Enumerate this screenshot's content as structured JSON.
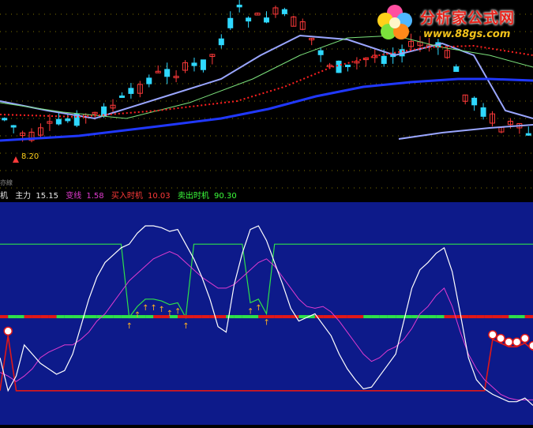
{
  "watermark": {
    "site_name": "分析家公式网",
    "url": "www.88gs.com"
  },
  "upper_chart": {
    "low_price_marker": "8.20",
    "left_edge_text": "亦線"
  },
  "indicator_bar": {
    "items": [
      {
        "label": "机",
        "value": "",
        "color": "#e8e8e8"
      },
      {
        "label": "主力",
        "value": "15.15",
        "color": "#e8e8e8"
      },
      {
        "label": "变线",
        "value": "1.58",
        "color": "#e23bd0"
      },
      {
        "label": "买入时机",
        "value": "10.03",
        "color": "#ff3a3a"
      },
      {
        "label": "卖出时机",
        "value": "90.30",
        "color": "#3cff3c"
      }
    ]
  },
  "colors": {
    "up_candle": "#ff3a3a",
    "down_candle": "#2fd8ff",
    "ma_short": "#9aa6ff",
    "ma_mid": "#7ce27c",
    "ma_long": "#2038ff",
    "ma_dotted": "#ff2020",
    "main_line": "#ffffff",
    "signal_line": "#e23bd0",
    "buy_band": "#2ee04a",
    "sell_band": "#e01818",
    "lower_bg": "#0d1a8a"
  },
  "chart_data": {
    "type": "line",
    "x": [
      1,
      2,
      3,
      4,
      5,
      6,
      7,
      8,
      9,
      10,
      11,
      12,
      13,
      14,
      15,
      16,
      17,
      18,
      19,
      20,
      21,
      22,
      23,
      24,
      25,
      26,
      27,
      28,
      29,
      30,
      31,
      32,
      33,
      34,
      35,
      36,
      37,
      38,
      39,
      40,
      41,
      42,
      43,
      44,
      45,
      46,
      47,
      48,
      49,
      50,
      51,
      52,
      53,
      54,
      55,
      56,
      57,
      58,
      59,
      60,
      61,
      62,
      63,
      64,
      65,
      66,
      67
    ],
    "series": [
      {
        "name": "主力",
        "values": [
          28,
          10,
          18,
          35,
          30,
          25,
          22,
          19,
          21,
          30,
          45,
          60,
          72,
          80,
          84,
          88,
          90,
          96,
          100,
          100,
          99,
          97,
          98,
          90,
          82,
          72,
          60,
          45,
          42,
          68,
          85,
          98,
          100,
          92,
          80,
          68,
          55,
          48,
          50,
          52,
          46,
          40,
          30,
          22,
          16,
          11,
          12,
          18,
          24,
          30,
          48,
          66,
          76,
          80,
          85,
          88,
          75,
          52,
          28,
          16,
          11,
          8,
          6,
          4,
          4,
          6,
          2
        ]
      },
      {
        "name": "变线",
        "values": [
          20,
          18,
          15,
          18,
          22,
          28,
          31,
          33,
          35,
          35,
          38,
          42,
          48,
          52,
          58,
          64,
          70,
          74,
          78,
          82,
          84,
          86,
          84,
          80,
          76,
          72,
          69,
          66,
          66,
          68,
          72,
          76,
          80,
          82,
          78,
          72,
          66,
          60,
          56,
          55,
          56,
          53,
          48,
          42,
          36,
          30,
          26,
          28,
          32,
          34,
          38,
          44,
          52,
          56,
          62,
          66,
          56,
          42,
          30,
          22,
          16,
          12,
          8,
          6,
          5,
          5,
          5
        ]
      },
      {
        "name": "买入时机",
        "values": [
          10,
          10,
          10,
          10,
          10,
          10,
          10,
          10,
          10,
          10,
          10,
          10,
          10,
          10,
          10,
          10,
          10,
          10,
          10,
          10,
          10,
          10,
          10,
          10,
          10,
          10,
          10,
          10,
          10,
          10,
          10,
          10,
          10,
          10,
          10,
          10,
          10,
          10,
          10,
          10,
          10,
          10,
          10,
          10,
          10,
          10,
          10,
          10,
          10,
          10,
          10,
          10,
          10,
          10,
          10,
          10,
          10,
          10,
          10,
          10,
          10,
          10,
          10,
          10,
          10,
          10,
          10
        ]
      },
      {
        "name": "卖出时机",
        "values": [
          90,
          90,
          90,
          90,
          90,
          90,
          90,
          90,
          90,
          90,
          90,
          90,
          90,
          90,
          90,
          90,
          90,
          90,
          90,
          90,
          90,
          90,
          90,
          90,
          90,
          90,
          90,
          90,
          90,
          90,
          90,
          90,
          90,
          90,
          90,
          90,
          90,
          90,
          90,
          90,
          90,
          90,
          90,
          90,
          90,
          90,
          90,
          90,
          90,
          90,
          90,
          90,
          90,
          90,
          90,
          90,
          90,
          90,
          90,
          90,
          90,
          90,
          90,
          90,
          90,
          90,
          90
        ]
      }
    ],
    "ylim": [
      0,
      100
    ],
    "grid": false
  }
}
